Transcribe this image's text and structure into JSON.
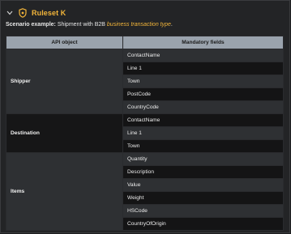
{
  "header": {
    "title": "Ruleset K",
    "chevron_icon": "chevron-down-icon",
    "badge_icon": "shield-icon",
    "accent_color": "#f2b53a"
  },
  "scenario": {
    "label": "Scenario example:",
    "text": " Shipment with B2B ",
    "emphasis": "business transaction type",
    "suffix": "."
  },
  "table": {
    "headers": [
      "API object",
      "Mandatory fields"
    ],
    "groups": [
      {
        "name": "Shipper",
        "fields": [
          "ContactName",
          "Line 1",
          "Town",
          "PostCode",
          "CountryCode"
        ]
      },
      {
        "name": "Destination",
        "fields": [
          "ContactName",
          "Line 1",
          "Town"
        ]
      },
      {
        "name": "Items",
        "fields": [
          "Quantity",
          "Description",
          "Value",
          "Weight",
          "HSCode",
          "CountryOfOrigin"
        ]
      }
    ]
  }
}
